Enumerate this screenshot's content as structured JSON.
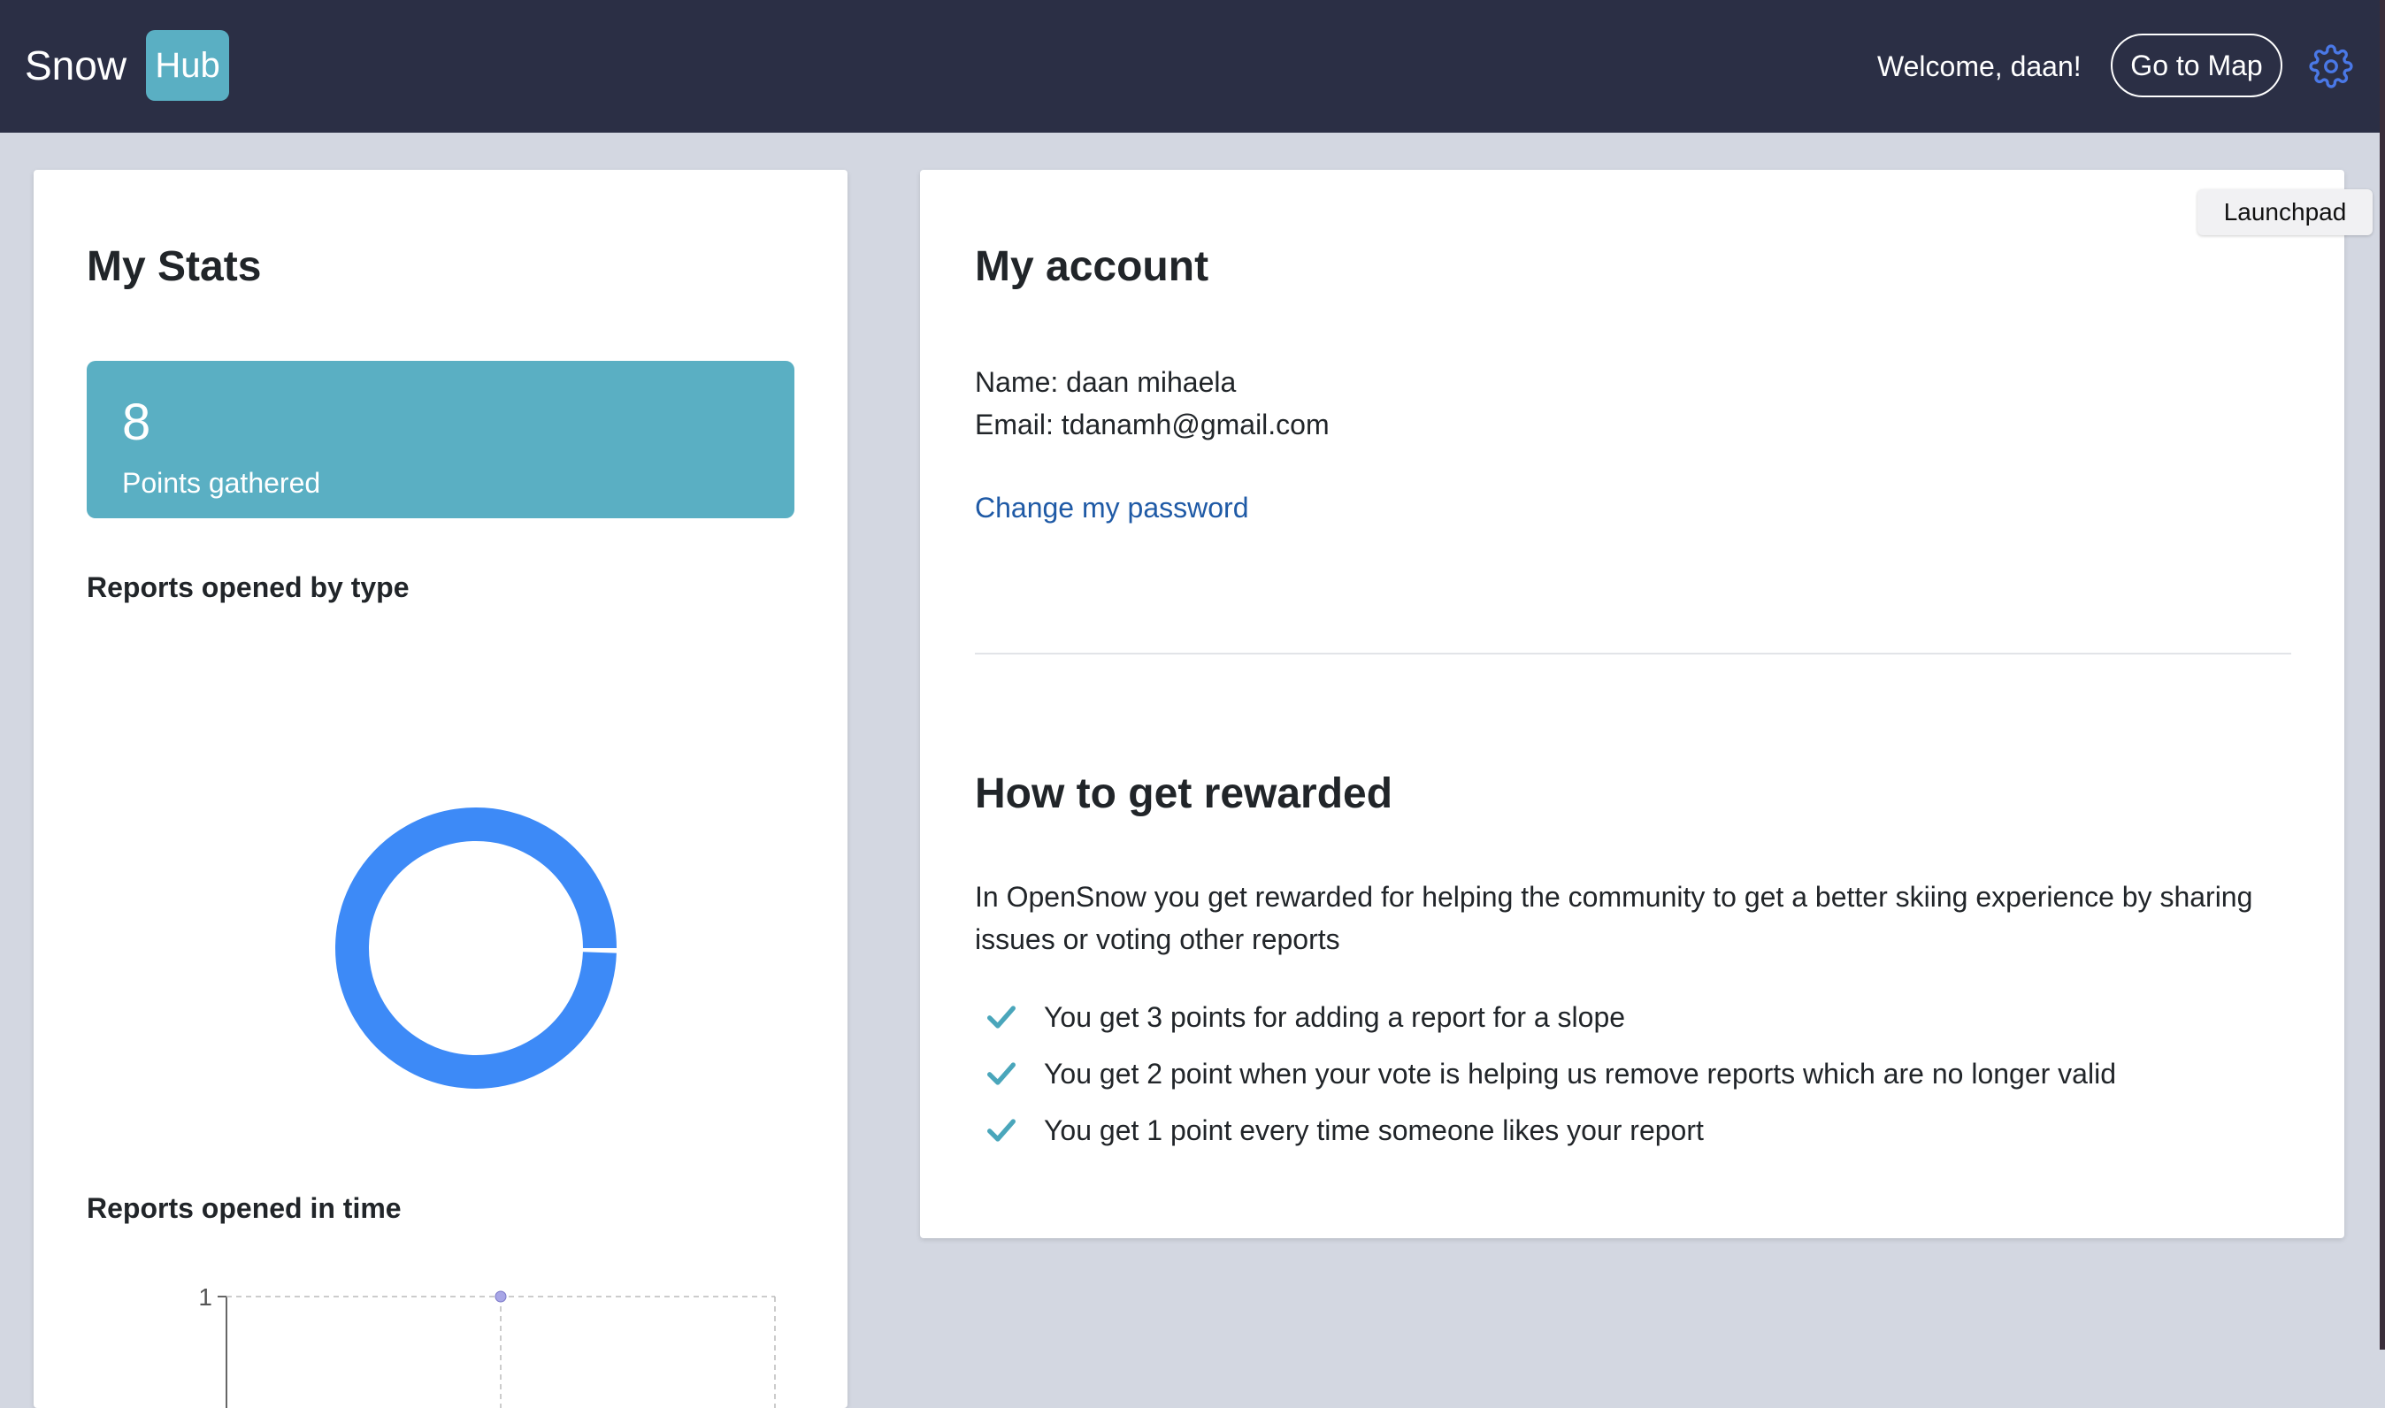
{
  "header": {
    "brand_snow": "Snow",
    "brand_hub": "Hub",
    "welcome": "Welcome, daan!",
    "go_to_map": "Go to Map",
    "settings_icon": "gear-icon"
  },
  "stats": {
    "title": "My Stats",
    "points_value": "8",
    "points_label": "Points gathered",
    "reports_by_type_label": "Reports opened by type",
    "reports_in_time_label": "Reports opened in time"
  },
  "account": {
    "title": "My account",
    "name_line": "Name: daan mihaela",
    "email_line": "Email: tdanamh@gmail.com",
    "change_password": "Change my password"
  },
  "rewards": {
    "title": "How to get rewarded",
    "intro": "In OpenSnow you get rewarded for helping the community to get a better skiing experience by sharing issues or voting other reports",
    "items": [
      "You get 3 points for adding a report for a slope",
      "You get 2 point when your vote is helping us remove reports which are no longer valid",
      "You get 1 point every time someone likes your report"
    ]
  },
  "tooltip": {
    "launchpad": "Launchpad"
  },
  "colors": {
    "navbar": "#2b2f45",
    "accent": "#5aafc3",
    "chart_blue": "#3d8af7",
    "check": "#4aa6bb",
    "link": "#1f5aa6"
  },
  "chart_data": [
    {
      "type": "pie",
      "title": "Reports opened by type",
      "slices": [
        {
          "label": "",
          "value": 1
        }
      ]
    },
    {
      "type": "line",
      "title": "Reports opened in time",
      "y_ticks": [
        "1"
      ],
      "series": [
        {
          "values": [
            1
          ]
        }
      ]
    }
  ]
}
